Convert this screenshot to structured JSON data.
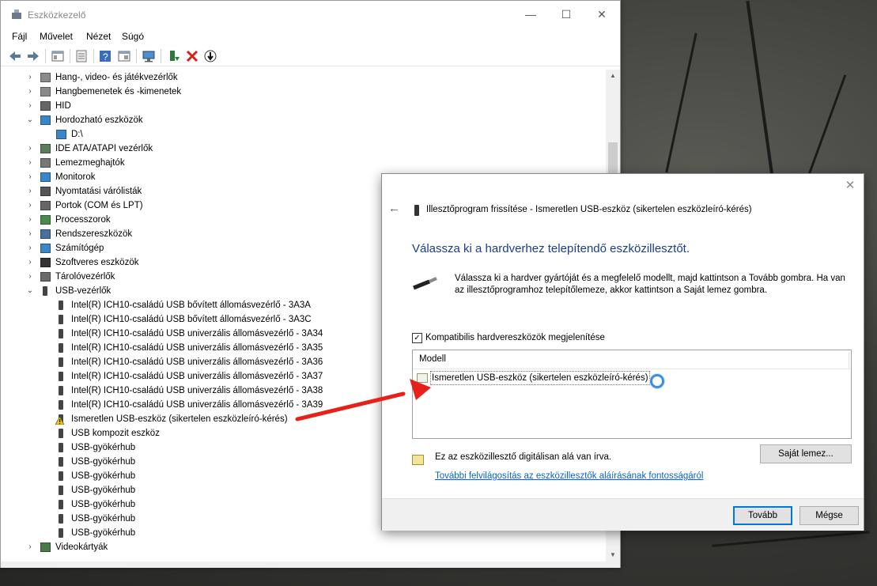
{
  "window": {
    "title": "Eszközkezelő",
    "minimize": "—",
    "maximize": "☐",
    "close": "✕"
  },
  "menu": [
    "Fájl",
    "Művelet",
    "Nézet",
    "Súgó"
  ],
  "tree": [
    {
      "label": "Hang-, video- és játékvezérlők",
      "level": 0,
      "expanded": false,
      "icon": "speaker-icon"
    },
    {
      "label": "Hangbemenetek és -kimenetek",
      "level": 0,
      "expanded": false,
      "icon": "speaker-icon"
    },
    {
      "label": "HID",
      "level": 0,
      "expanded": false,
      "icon": "hid-icon"
    },
    {
      "label": "Hordozható eszközök",
      "level": 0,
      "expanded": true,
      "icon": "portable-device-icon"
    },
    {
      "label": "D:\\",
      "level": 1,
      "icon": "portable-device-icon"
    },
    {
      "label": "IDE ATA/ATAPI vezérlők",
      "level": 0,
      "expanded": false,
      "icon": "ide-controller-icon"
    },
    {
      "label": "Lemezmeghajtók",
      "level": 0,
      "expanded": false,
      "icon": "disk-drive-icon"
    },
    {
      "label": "Monitorok",
      "level": 0,
      "expanded": false,
      "icon": "monitor-icon"
    },
    {
      "label": "Nyomtatási várólisták",
      "level": 0,
      "expanded": false,
      "icon": "printer-icon"
    },
    {
      "label": "Portok (COM és LPT)",
      "level": 0,
      "expanded": false,
      "icon": "port-icon"
    },
    {
      "label": "Processzorok",
      "level": 0,
      "expanded": false,
      "icon": "processor-icon"
    },
    {
      "label": "Rendszereszközök",
      "level": 0,
      "expanded": false,
      "icon": "system-device-icon"
    },
    {
      "label": "Számítógép",
      "level": 0,
      "expanded": false,
      "icon": "computer-icon"
    },
    {
      "label": "Szoftveres eszközök",
      "level": 0,
      "expanded": false,
      "icon": "software-device-icon"
    },
    {
      "label": "Tárolóvezérlők",
      "level": 0,
      "expanded": false,
      "icon": "storage-controller-icon"
    },
    {
      "label": "USB-vezérlők",
      "level": 0,
      "expanded": true,
      "icon": "usb-icon"
    },
    {
      "label": "Intel(R) ICH10-családú USB bővített állomásvezérlő - 3A3A",
      "level": 1,
      "icon": "usb-icon"
    },
    {
      "label": "Intel(R) ICH10-családú USB bővített állomásvezérlő - 3A3C",
      "level": 1,
      "icon": "usb-icon"
    },
    {
      "label": "Intel(R) ICH10-családú USB univerzális állomásvezérlő - 3A34",
      "level": 1,
      "icon": "usb-icon"
    },
    {
      "label": "Intel(R) ICH10-családú USB univerzális állomásvezérlő - 3A35",
      "level": 1,
      "icon": "usb-icon"
    },
    {
      "label": "Intel(R) ICH10-családú USB univerzális állomásvezérlő - 3A36",
      "level": 1,
      "icon": "usb-icon"
    },
    {
      "label": "Intel(R) ICH10-családú USB univerzális állomásvezérlő - 3A37",
      "level": 1,
      "icon": "usb-icon"
    },
    {
      "label": "Intel(R) ICH10-családú USB univerzális állomásvezérlő - 3A38",
      "level": 1,
      "icon": "usb-icon"
    },
    {
      "label": "Intel(R) ICH10-családú USB univerzális állomásvezérlő - 3A39",
      "level": 1,
      "icon": "usb-icon"
    },
    {
      "label": "Ismeretlen USB-eszköz (sikertelen eszközleíró-kérés)",
      "level": 1,
      "icon": "warning-usb-icon"
    },
    {
      "label": "USB kompozit eszköz",
      "level": 1,
      "icon": "usb-icon"
    },
    {
      "label": "USB-gyökérhub",
      "level": 1,
      "icon": "usb-icon"
    },
    {
      "label": "USB-gyökérhub",
      "level": 1,
      "icon": "usb-icon"
    },
    {
      "label": "USB-gyökérhub",
      "level": 1,
      "icon": "usb-icon"
    },
    {
      "label": "USB-gyökérhub",
      "level": 1,
      "icon": "usb-icon"
    },
    {
      "label": "USB-gyökérhub",
      "level": 1,
      "icon": "usb-icon"
    },
    {
      "label": "USB-gyökérhub",
      "level": 1,
      "icon": "usb-icon"
    },
    {
      "label": "USB-gyökérhub",
      "level": 1,
      "icon": "usb-icon"
    },
    {
      "label": "Videokártyák",
      "level": 0,
      "expanded": false,
      "icon": "display-adapter-icon"
    }
  ],
  "dialog": {
    "close": "✕",
    "back": "←",
    "header": "Illesztőprogram frissítése - Ismeretlen USB-eszköz (sikertelen eszközleíró-kérés)",
    "heading": "Válassza ki a hardverhez telepítendő eszközillesztőt.",
    "description": "Válassza ki a hardver gyártóját és a megfelelő modellt, majd kattintson a Tovább gombra. Ha van az illesztőprogramhoz telepítőlemeze, akkor kattintson a Saját lemez gombra.",
    "checkbox_label": "Kompatibilis hardvereszközök megjelenítése",
    "checkbox_mark": "✓",
    "checkbox_checked": true,
    "list_header": "Modell",
    "list_item": "Ismeretlen USB-eszköz (sikertelen eszközleíró-kérés)",
    "signed_text": "Ez az eszközillesztő digitálisan alá van írva.",
    "link_text": "További felvilágosítás az eszközillesztők aláírásának fontosságáról",
    "have_disk": "Saját lemez...",
    "next": "Tovább",
    "cancel": "Mégse"
  },
  "colors": {
    "arrow": "#e8201a",
    "link": "#0066cc",
    "heading": "#1a3e8c",
    "accent_button_border": "#0078d7"
  }
}
